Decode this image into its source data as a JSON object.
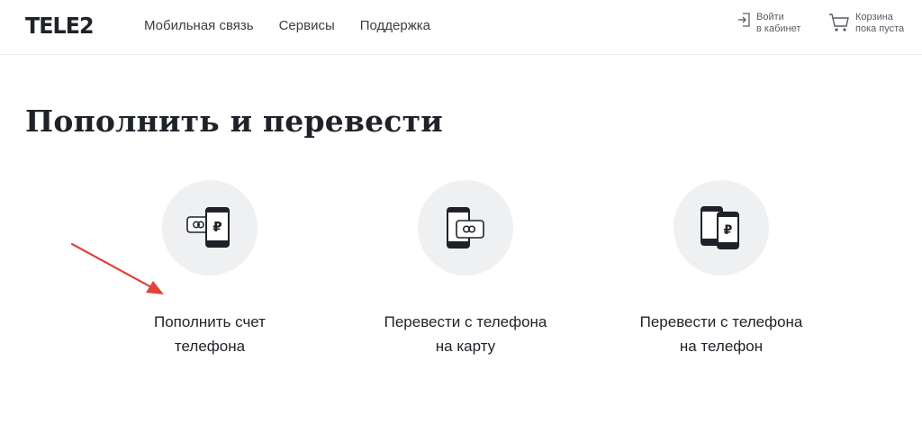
{
  "header": {
    "logo": "TELE2",
    "nav": [
      {
        "label": "Мобильная связь"
      },
      {
        "label": "Сервисы"
      },
      {
        "label": "Поддержка"
      }
    ],
    "login": {
      "line1": "Войти",
      "line2": "в кабинет",
      "icon": "login-icon"
    },
    "cart": {
      "line1": "Корзина",
      "line2": "пока пуста",
      "icon": "cart-icon"
    }
  },
  "main": {
    "title": "Пополнить и перевести",
    "cards": [
      {
        "line1": "Пополнить счет",
        "line2": "телефона",
        "icon": "phone-ruble-card-icon"
      },
      {
        "line1": "Перевести с телефона",
        "line2": "на карту",
        "icon": "phone-to-card-icon"
      },
      {
        "line1": "Перевести с телефона",
        "line2": "на телефон",
        "icon": "phone-to-phone-icon"
      }
    ]
  },
  "colors": {
    "text": "#1f2229",
    "circle_bg": "#eef0f2",
    "annotation_arrow": "#e0433a"
  }
}
